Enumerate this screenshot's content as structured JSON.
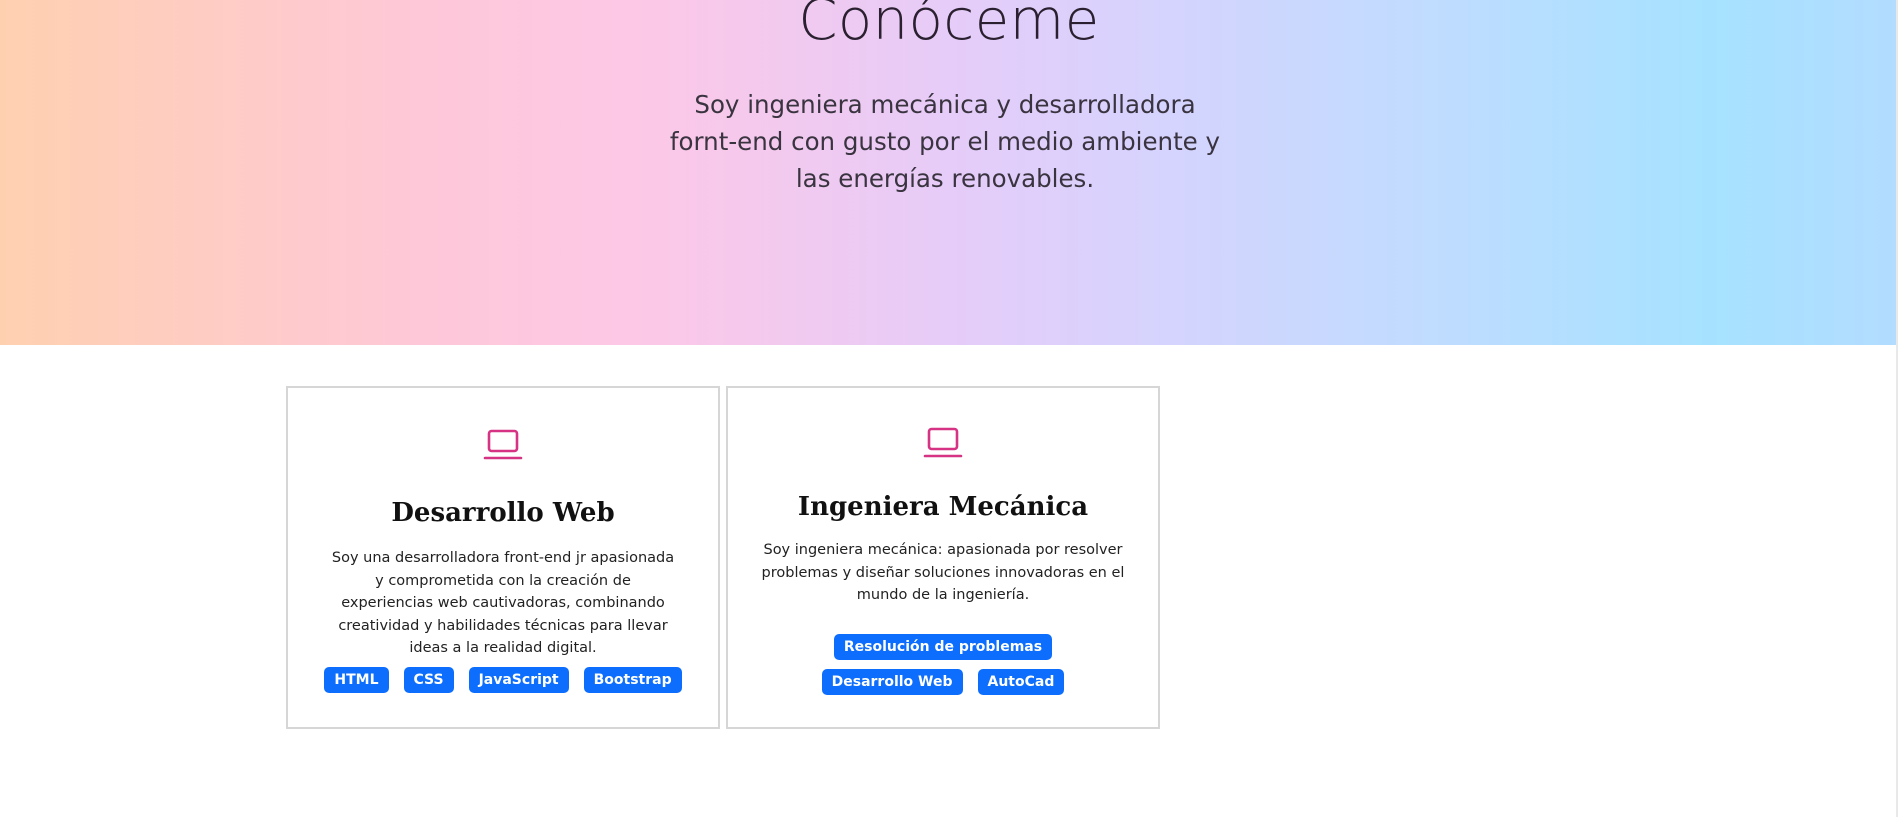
{
  "hero": {
    "title": "Conóceme",
    "subtitle": "Soy ingeniera mecánica y desarrolladora fornt-end con gusto por el medio ambiente y las energías renovables."
  },
  "cards": [
    {
      "icon": "laptop-icon",
      "title": "Desarrollo Web",
      "text": "Soy una desarrolladora front-end jr apasionada y comprometida con la creación de experiencias web cautivadoras, combinando creatividad y habilidades técnicas para llevar ideas a la realidad digital.",
      "tags": [
        "HTML",
        "CSS",
        "JavaScript",
        "Bootstrap"
      ]
    },
    {
      "icon": "laptop-icon",
      "title": "Ingeniera Mecánica",
      "text": "Soy ingeniera mecánica: apasionada por resolver problemas y diseñar soluciones innovadoras en el mundo de la ingeniería.",
      "tags": [
        "Resolución de problemas",
        "Desarrollo Web",
        "AutoCad"
      ]
    }
  ],
  "colors": {
    "accent_icon": "#d63384",
    "tag_background": "#0d6efd",
    "tag_text": "#ffffff"
  }
}
